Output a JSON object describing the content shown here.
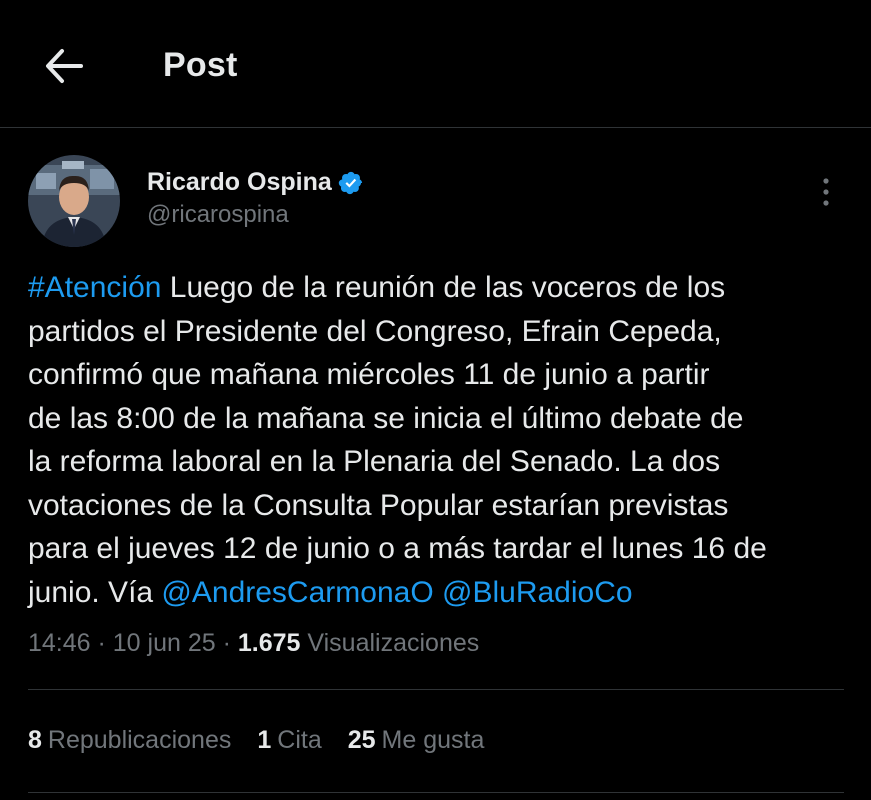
{
  "header": {
    "title": "Post",
    "back_icon": "arrow-left-icon"
  },
  "post": {
    "author": {
      "name": "Ricardo Ospina",
      "handle": "@ricarospina",
      "verified": true
    },
    "text_lines": [
      {
        "hashtag": "#Atención",
        "rest": " Luego de la reunión de las voceros de los"
      },
      {
        "text": "partidos el Presidente del Congreso, Efrain Cepeda,"
      },
      {
        "text": "confirmó que mañana miércoles 11 de junio a partir"
      },
      {
        "text": "de las 8:00 de la mañana se inicia el último debate de"
      },
      {
        "text": "la reforma laboral en la Plenaria del Senado. La dos"
      },
      {
        "text": "votaciones de la Consulta Popular estarían previstas"
      },
      {
        "text": "para el jueves 12 de junio o a más tardar el lunes 16 de"
      },
      {
        "prefix": "junio. Vía ",
        "mention1": "@AndresCarmonaO",
        "space": " ",
        "mention2": "@BluRadioCo"
      }
    ],
    "meta": {
      "time": "14:46",
      "separator": " · ",
      "date": "10 jun 25",
      "views_count": "1.675",
      "views_label": " Visualizaciones"
    },
    "stats": {
      "reposts_count": "8",
      "reposts_label": "Republicaciones",
      "quotes_count": "1",
      "quotes_label": "Cita",
      "likes_count": "25",
      "likes_label": "Me gusta"
    }
  },
  "colors": {
    "background": "#000000",
    "text_primary": "#e7e9ea",
    "text_secondary": "#71767b",
    "link": "#1d9bf0",
    "divider": "#2f3336",
    "verified": "#1d9bf0"
  }
}
